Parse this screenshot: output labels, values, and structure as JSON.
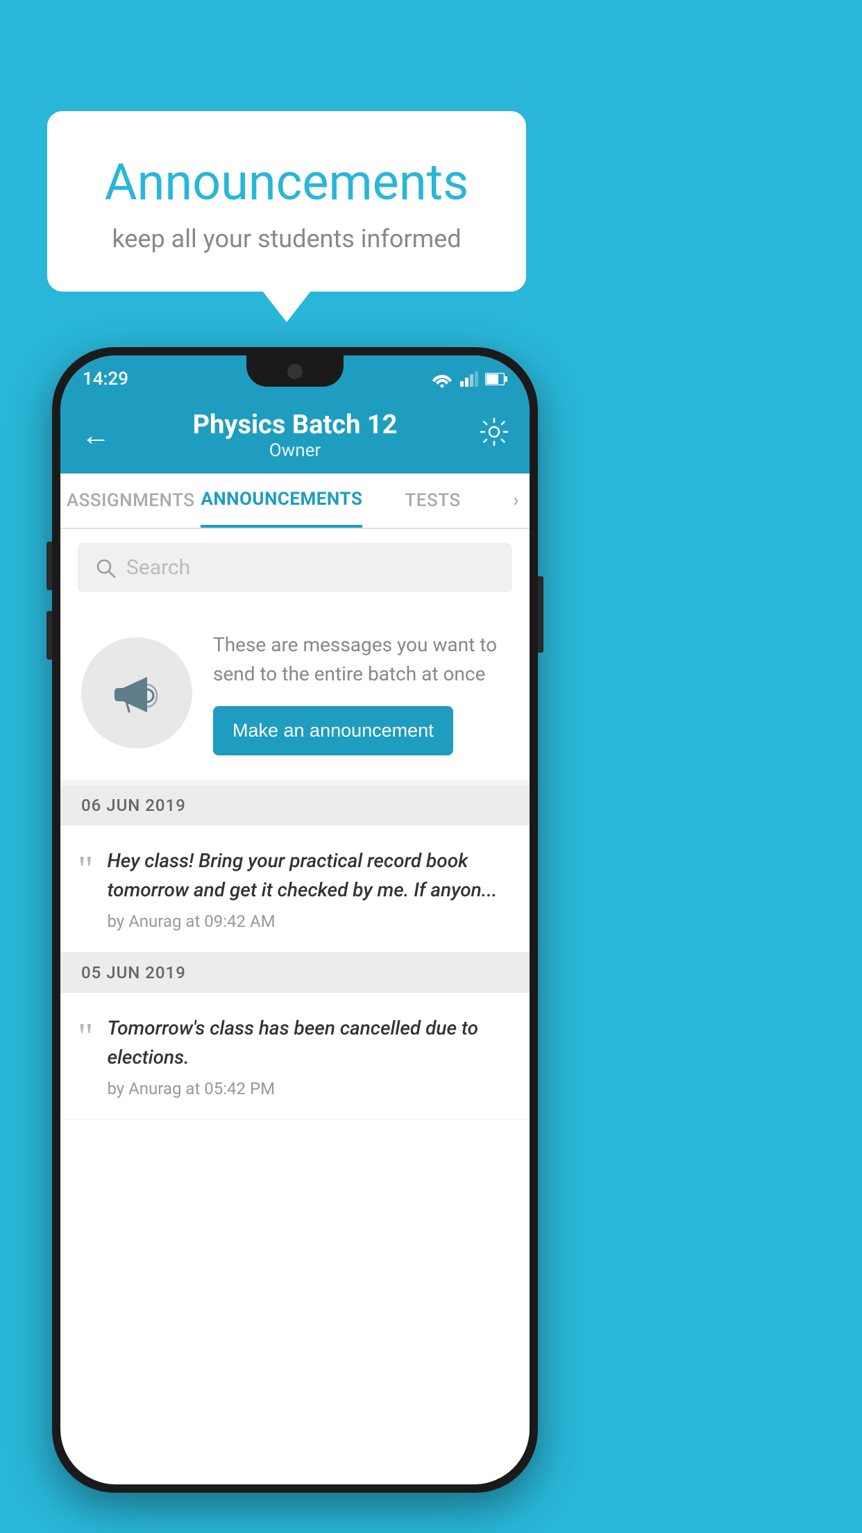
{
  "background_color": "#29b6d8",
  "speech_bubble": {
    "title": "Announcements",
    "subtitle": "keep all your students informed"
  },
  "phone": {
    "status_bar": {
      "time": "14:29"
    },
    "top_bar": {
      "title": "Physics Batch 12",
      "subtitle": "Owner",
      "back_label": "←",
      "settings_label": "⚙"
    },
    "tabs": [
      {
        "label": "ASSIGNMENTS",
        "active": false
      },
      {
        "label": "ANNOUNCEMENTS",
        "active": true
      },
      {
        "label": "TESTS",
        "active": false
      }
    ],
    "search": {
      "placeholder": "Search"
    },
    "announcement_cta": {
      "description": "These are messages you want to send to the entire batch at once",
      "button_label": "Make an announcement"
    },
    "announcements": [
      {
        "date": "06  JUN  2019",
        "text": "Hey class! Bring your practical record book tomorrow and get it checked by me. If anyon...",
        "meta": "by Anurag at 09:42 AM"
      },
      {
        "date": "05  JUN  2019",
        "text": "Tomorrow's class has been cancelled due to elections.",
        "meta": "by Anurag at 05:42 PM"
      }
    ]
  }
}
